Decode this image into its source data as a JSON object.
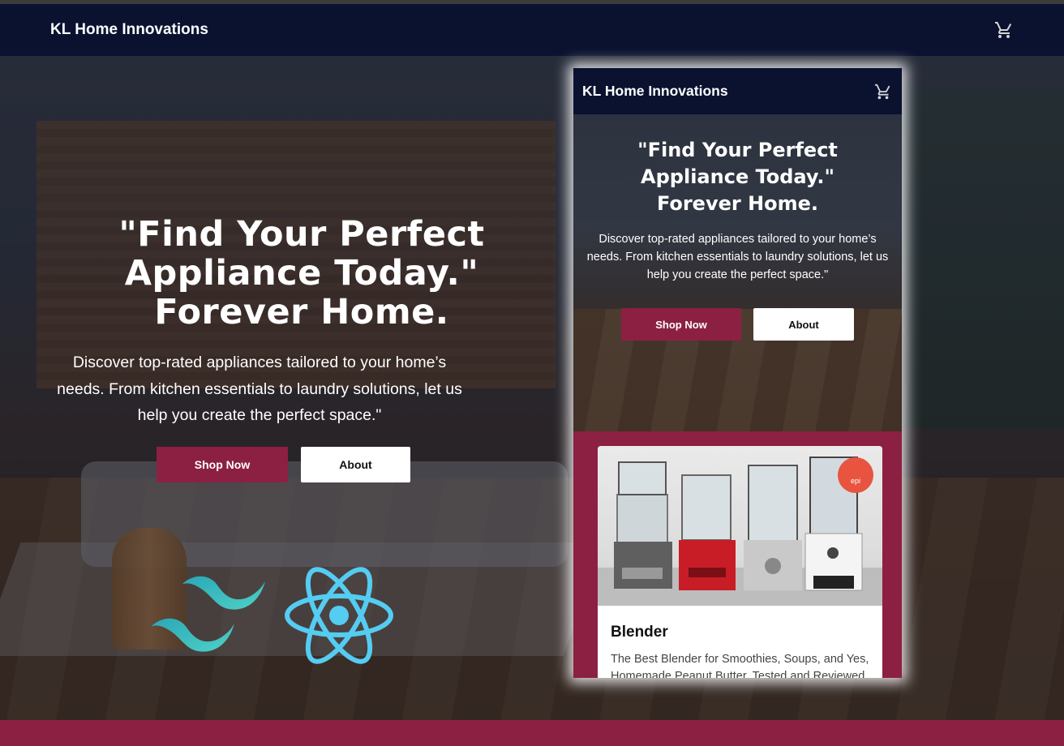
{
  "app": {
    "brand": "KL Home Innovations",
    "cart_icon": "cart-icon"
  },
  "hero": {
    "headline": "\"Find Your Perfect Appliance Today.\" Forever Home.",
    "description": "Discover top-rated appliances tailored to your home’s needs. From kitchen essentials to laundry solutions, let us help you create the perfect space.\"",
    "shop_label": "Shop Now",
    "about_label": "About"
  },
  "mobile_preview": {
    "brand": "KL Home Innovations",
    "headline": "\"Find Your Perfect Appliance Today.\" Forever Home.",
    "description": "Discover top-rated appliances tailored to your home’s needs. From kitchen essentials to laundry solutions, let us help you create the perfect space.\"",
    "shop_label": "Shop Now",
    "about_label": "About",
    "product": {
      "title": "Blender",
      "description": "The Best Blender for Smoothies, Soups, and Yes, Homemade Peanut Butter, Tested and Reviewed"
    }
  },
  "logos": [
    "tailwind-logo",
    "react-logo"
  ],
  "colors": {
    "navbar": "#0a1230",
    "accent": "#8c2042",
    "white": "#ffffff"
  }
}
